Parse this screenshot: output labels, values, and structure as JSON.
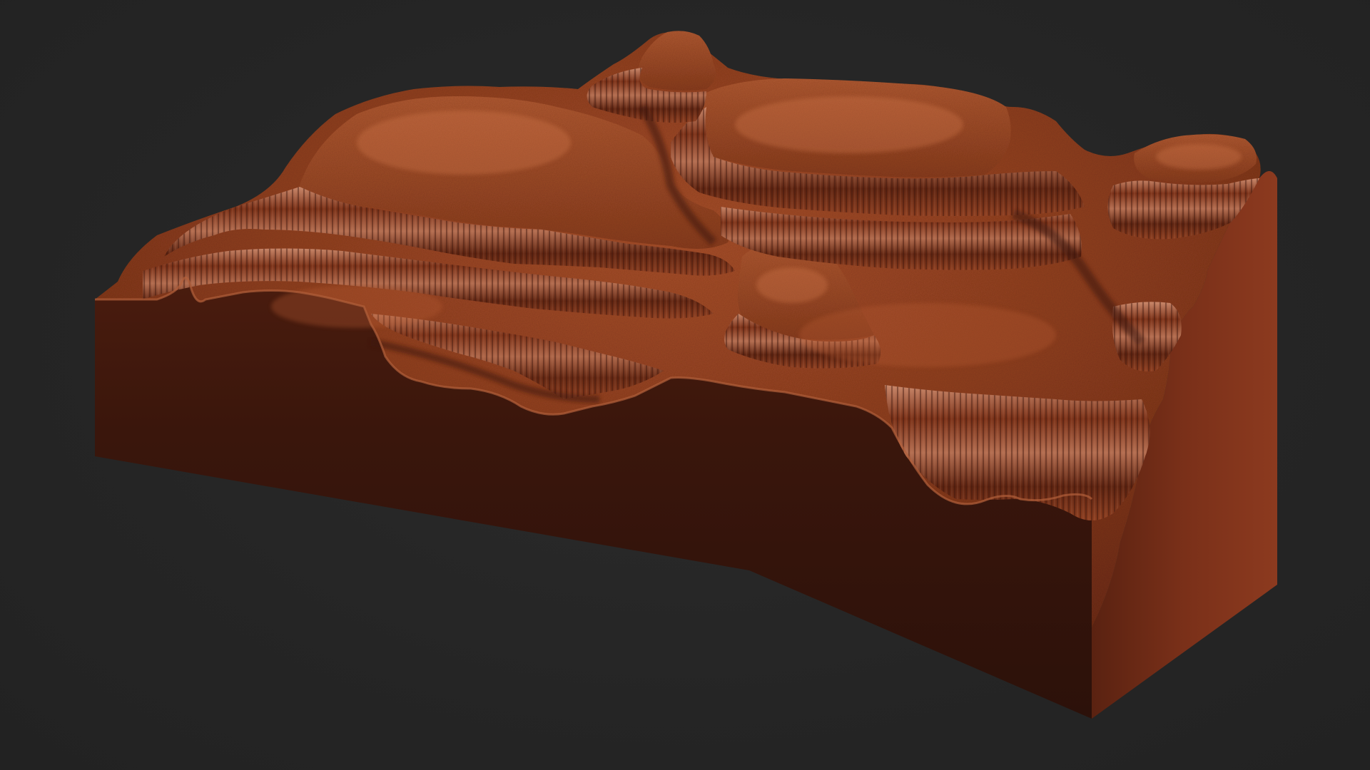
{
  "scene": {
    "subject": "terrain-block",
    "colors": {
      "background": "#252525",
      "front_face": "#3a160c",
      "right_face": "#6e2a15",
      "terrain_base": "#8a3a1c",
      "terrain_light": "#c0643a",
      "terrain_highlight": "#e6a98a",
      "terrain_shadow": "#3c150a"
    }
  }
}
